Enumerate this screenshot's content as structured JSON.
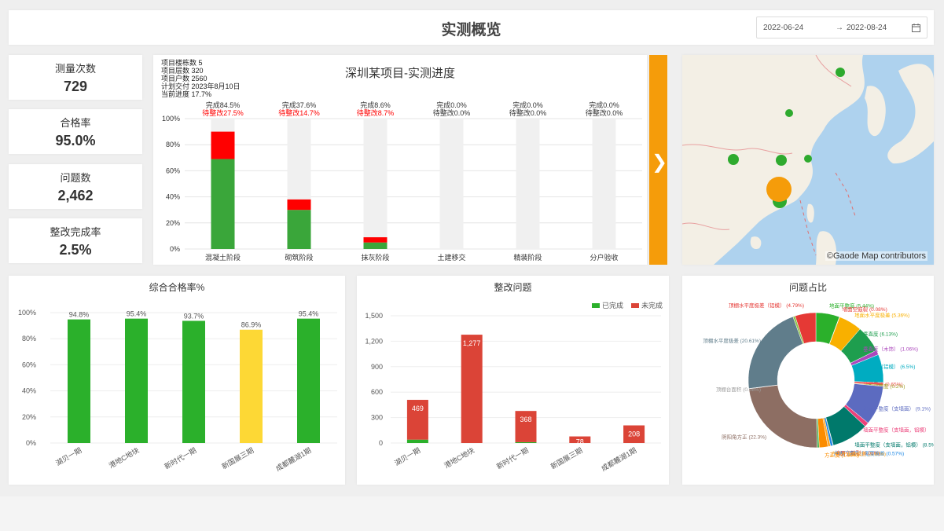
{
  "header": {
    "title": "实测概览",
    "date_start": "2022-06-24",
    "date_arrow": "→",
    "date_end": "2022-08-24",
    "calendar_icon": "calendar-icon"
  },
  "stats": [
    {
      "label": "测量次数",
      "value": "729"
    },
    {
      "label": "合格率",
      "value": "95.0%"
    },
    {
      "label": "问题数",
      "value": "2,462"
    },
    {
      "label": "整改完成率",
      "value": "2.5%"
    }
  ],
  "progress": {
    "info": [
      "项目楼栋数 5",
      "项目层数 320",
      "项目户数 2560",
      "计划交付 2023年8月10日",
      "当前进度 17.7%"
    ],
    "title": "深圳某项目-实测进度",
    "side_arrow": "❯",
    "colors": {
      "done": "#3aa63a",
      "rectify": "#ff0000",
      "track": "#f0f0f0",
      "text_red": "#ff0000"
    },
    "chart_data": {
      "type": "bar",
      "categories": [
        "混凝土阶段",
        "砌筑阶段",
        "抹灰阶段",
        "土建移交",
        "精装阶段",
        "分户验收"
      ],
      "series": [
        {
          "name": "完成",
          "values": [
            69,
            30,
            5,
            0,
            0,
            0
          ]
        },
        {
          "name": "待整改",
          "values": [
            21,
            8,
            4,
            0,
            0,
            0
          ]
        }
      ],
      "done_labels": [
        "完成84.5%",
        "完成37.6%",
        "完成8.6%",
        "完成0.0%",
        "完成0.0%",
        "完成0.0%"
      ],
      "rectify_labels": [
        "待整改27.5%",
        "待整改14.7%",
        "待整改8.7%",
        "待整改0.0%",
        "待整改0.0%",
        "待整改0.0%"
      ],
      "yticks": [
        "0%",
        "20%",
        "40%",
        "60%",
        "80%",
        "100%"
      ],
      "ylim": [
        0,
        100
      ]
    }
  },
  "map": {
    "attribution": "©Gaode Map contributors",
    "colors": {
      "water": "#aed2ee",
      "land": "#f3efe5",
      "dot": "#2eaa2e",
      "highlight": "#f59c0a",
      "border": "#e8a0a0"
    }
  },
  "pass_rate": {
    "title": "综合合格率%",
    "colors": {
      "green": "#2bb02b",
      "yellow": "#fdd835"
    },
    "chart_data": {
      "type": "bar",
      "categories": [
        "湖贝一期",
        "港地C地块",
        "新时代一期",
        "新国展三期",
        "成都麓湖1期"
      ],
      "values": [
        94.8,
        95.4,
        93.7,
        86.9,
        95.4
      ],
      "labels": [
        "94.8%",
        "95.4%",
        "93.7%",
        "86.9%",
        "95.4%"
      ],
      "bar_colors": [
        "green",
        "green",
        "green",
        "yellow",
        "green"
      ],
      "yticks": [
        "0%",
        "20%",
        "40%",
        "60%",
        "80%",
        "100%"
      ],
      "ylim": [
        0,
        100
      ]
    }
  },
  "rectify": {
    "title": "整改问题",
    "colors": {
      "done": "#2bb02b",
      "undone": "#db4437"
    },
    "chart_data": {
      "type": "bar",
      "categories": [
        "湖贝一期",
        "港地C地块",
        "新时代一期",
        "新国展三期",
        "成都麓湖1期"
      ],
      "series": [
        {
          "name": "已完成",
          "values": [
            40,
            0,
            10,
            0,
            0
          ]
        },
        {
          "name": "未完成",
          "values": [
            469,
            1277,
            368,
            78,
            208
          ]
        }
      ],
      "labels": [
        "469",
        "1,277",
        "368",
        "78",
        "208"
      ],
      "yticks": [
        "0",
        "300",
        "600",
        "900",
        "1,200",
        "1,500"
      ],
      "ylim": [
        0,
        1500
      ]
    }
  },
  "issues": {
    "title": "问题占比",
    "chart_data": {
      "type": "pie",
      "slices": [
        {
          "name": "地面平整度",
          "pct": 5.44,
          "label": "(5.44%)",
          "color": "#2bb02b"
        },
        {
          "name": "墙面空鼓裂",
          "pct": 0.08,
          "label": "(0.08%)",
          "color": "#e53935"
        },
        {
          "name": "地面水平度极差",
          "pct": 5.36,
          "label": "(5.36%)",
          "color": "#f9b000"
        },
        {
          "name": "垂直度",
          "pct": 6.13,
          "label": "(6.13%)",
          "color": "#1e9e4e"
        },
        {
          "name": "垂直度（木饰）",
          "pct": 1.06,
          "label": "(1.06%)",
          "color": "#ab47bc"
        },
        {
          "name": "垂直度（铝模）",
          "pct": 6.5,
          "label": "(6.5%)",
          "color": "#00acc1"
        },
        {
          "name": "墙面尺寸",
          "pct": 0.65,
          "label": "(0.65%)",
          "color": "#ef5350"
        },
        {
          "name": "墙面平整度",
          "pct": 0.2,
          "label": "(0.2%)",
          "color": "#9e9d24"
        },
        {
          "name": "墙面平整度（支墙面）",
          "pct": 9.1,
          "label": "(9.1%)",
          "color": "#5c6bc0"
        },
        {
          "name": "墙面平整度（支墙面，铝模）",
          "pct": 1.0,
          "label": "",
          "color": "#ec407a"
        },
        {
          "name": "墙面平整度（支墙面，铝模）",
          "pct": 8.5,
          "label": "(8.5%)",
          "color": "#00796b"
        },
        {
          "name": "墙面空鼓裂",
          "pct": 0.08,
          "label": "(0.08%)",
          "color": "#c62828"
        },
        {
          "name": "户内门洞尺寸宽度偏差",
          "pct": 0.57,
          "label": "(0.57%)",
          "color": "#1e88e5"
        },
        {
          "name": "户内开合面偏差",
          "pct": 0.6,
          "label": "(0.60%)",
          "color": "#ffa726"
        },
        {
          "name": "方正度",
          "pct": 1.99,
          "label": "(1.99%)",
          "color": "#fb8c00"
        },
        {
          "name": "",
          "pct": 0.5,
          "label": "",
          "color": "#4caf50"
        },
        {
          "name": "阴阳角方正",
          "pct": 22.3,
          "label": "(22.3%)",
          "color": "#8d6e63"
        },
        {
          "name": "顶棚台面积",
          "pct": 0.08,
          "label": "(0.08%)",
          "color": "#9e9e9e"
        },
        {
          "name": "顶棚水平度极差",
          "pct": 20.61,
          "label": "(20.61%)",
          "color": "#607d8b"
        },
        {
          "name": "",
          "pct": 0.5,
          "label": "",
          "color": "#8bc34a"
        },
        {
          "name": "顶棚水平度极差（铝模）",
          "pct": 4.79,
          "label": "(4.79%)",
          "color": "#e53935"
        }
      ]
    }
  }
}
